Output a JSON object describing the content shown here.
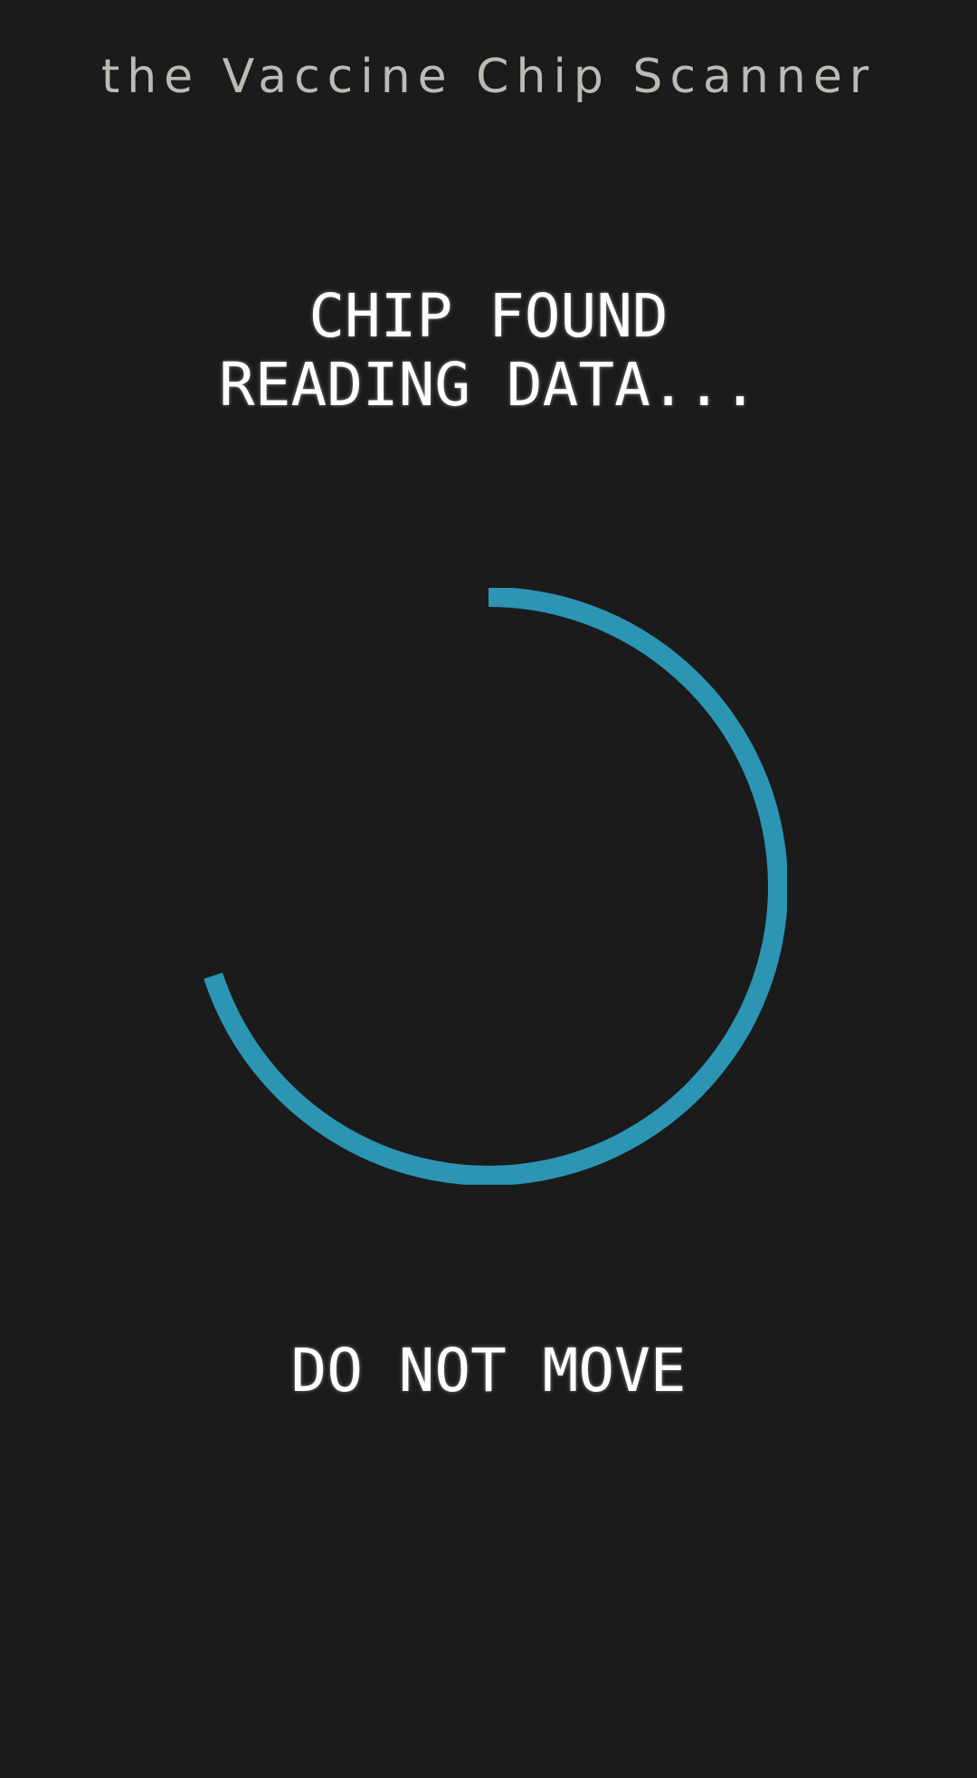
{
  "app": {
    "title": "the Vaccine Chip Scanner"
  },
  "status": {
    "line1": "CHIP FOUND",
    "line2": "READING DATA..."
  },
  "progress": {
    "fraction": 0.7,
    "color": "#2b95b3",
    "background": "#1b1b1b"
  },
  "warning": {
    "text": "DO NOT MOVE"
  }
}
